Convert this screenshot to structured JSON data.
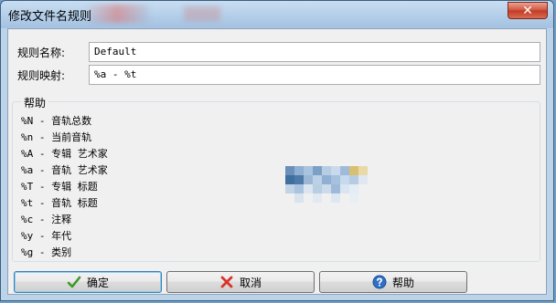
{
  "window": {
    "title": "修改文件名规则",
    "close_glyph": "✕"
  },
  "form": {
    "name_label": "规则名称:",
    "name_value": "Default",
    "mapping_label": "规则映射:",
    "mapping_value": "%a - %t"
  },
  "help": {
    "title": "帮助",
    "items": [
      "%N - 音轨总数",
      "%n - 当前音轨",
      "%A - 专辑 艺术家",
      "%a - 音轨 艺术家",
      "%T - 专辑 标题",
      "%t - 音轨 标题",
      "%c - 注释",
      "%y - 年代",
      "%g - 类别"
    ]
  },
  "buttons": {
    "ok": "确定",
    "cancel": "取消",
    "help": "帮助"
  },
  "icons": {
    "ok": "check-icon",
    "cancel": "x-icon",
    "help": "question-icon",
    "colors": {
      "ok": "#3a9a2a",
      "cancel": "#d9342b",
      "help": "#2f6fc4"
    }
  }
}
